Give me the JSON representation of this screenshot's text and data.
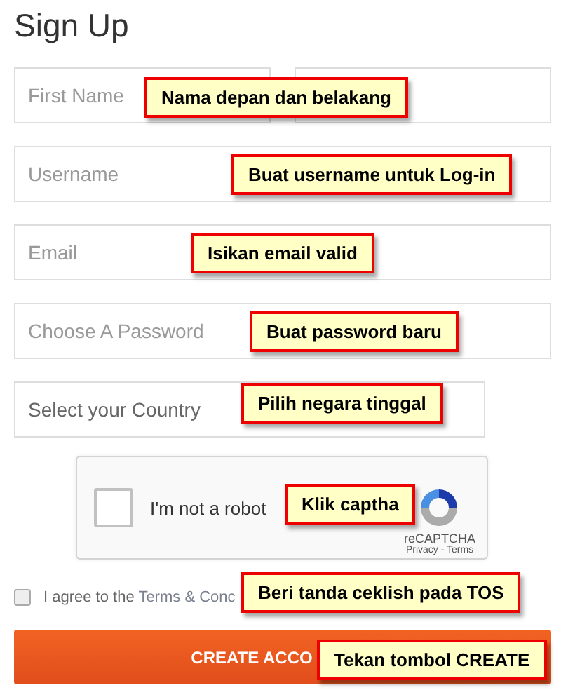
{
  "title": "Sign Up",
  "first_name": {
    "placeholder": "First Name"
  },
  "fields": [
    {
      "kind": "text",
      "placeholder": "Username"
    },
    {
      "kind": "text",
      "placeholder": "Email"
    },
    {
      "kind": "password",
      "placeholder": "Choose A Password"
    },
    {
      "kind": "select",
      "value": "Select your Country"
    }
  ],
  "captcha": {
    "label": "I'm not a robot",
    "checked": false,
    "brand": "reCAPTCHA",
    "links": "Privacy - Terms"
  },
  "agreement": {
    "checked": false,
    "text": "I agree to the ",
    "link": "Terms & Conc"
  },
  "submit": {
    "label": "CREATE ACCO"
  },
  "callouts": [
    {
      "text": "Nama depan dan belakang"
    },
    {
      "text": "Buat username untuk Log-in"
    },
    {
      "text": "Isikan email valid"
    },
    {
      "text": "Buat password baru"
    },
    {
      "text": "Pilih negara tinggal"
    },
    {
      "text": "Klik captha"
    },
    {
      "text": "Beri tanda ceklish pada TOS"
    },
    {
      "text": "Tekan tombol CREATE"
    }
  ]
}
